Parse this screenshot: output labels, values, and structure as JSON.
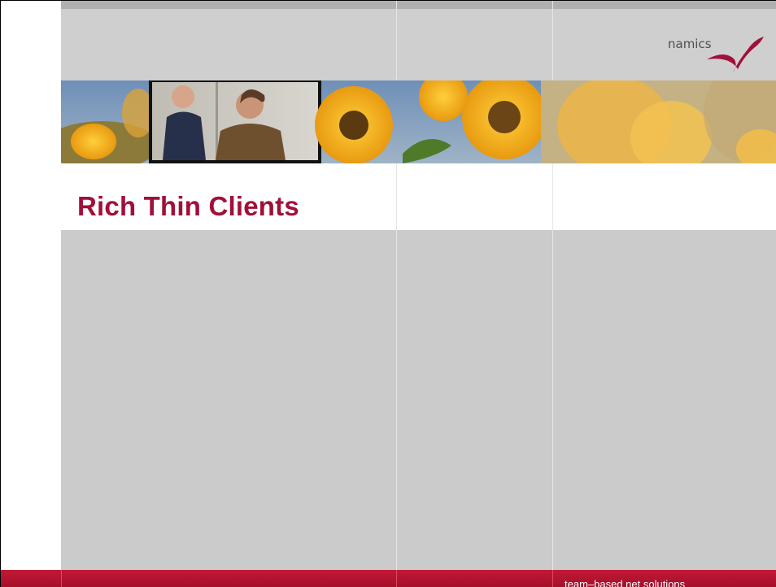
{
  "slide": {
    "title": "Rich Thin Clients",
    "tagline": "team–based net solutions"
  },
  "brand": {
    "logo_text": "namics",
    "logo_color": "#a0103a",
    "title_color": "#a0103a",
    "footer_color": "#b5132f",
    "panel_gray": "#cbcbcb"
  },
  "banner": {
    "image": "sunflower-photo-strip-with-two-people"
  }
}
